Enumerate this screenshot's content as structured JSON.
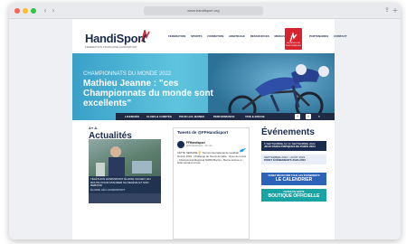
{
  "browser": {
    "url": "www.handisport.org",
    "nav_back": "‹",
    "nav_forward": "›",
    "share_icon": "share-icon",
    "add_tab_icon": "plus-icon"
  },
  "site": {
    "logo": "HandiSport",
    "logo_sub": "FÉDÉRATION FRANÇAISE HANDISPORT",
    "nav_left": [
      "FÉDÉRATION",
      "SPORTS",
      "FORMATION",
      "ARBITRAGE",
      "RESSOURCES",
      "MÉDIAS"
    ],
    "flag_text": "AGITATEUR DE PERFORMANCES",
    "nav_right": [
      "PARTENAIRES",
      "CONTACT"
    ],
    "hero_kicker": "CHAMPIONNATS DU MONDE 2022",
    "hero_title": "Mathieu Jeanne : \"ces Championnats du monde sont excellents\"",
    "toolbar": [
      "LICENCIÉS",
      "CLUBS & COMITÉS",
      "POUR LES JEUNES",
      "PERFORMANCE",
      "VIVE & BOUGE"
    ],
    "font_size_control": "A+ A-",
    "news_title": "Actualités",
    "news_caption": "TÉLÉTHON HANDISPORT ÉLODIE VACHET, EN ROUTE POUR ASSURER SA RELÈVE ET SON REBOND",
    "news_more": "ÉLODIE LÉO HANDISPORT"
  },
  "tweets": {
    "title": "Tweets de @FFHandisport",
    "name": "FFHandisport",
    "handle": "@FFHandisport · 40 min",
    "text": "CETTE SEMAINE 🏆 Tournoi international de Goalball féminin 2022 · Challenge de Tennis de table · Open de tennis · Championnat Régional NORM Boccia · Bonne lecture et belle semaine à tous"
  },
  "events": {
    "title": "Événements",
    "items": [
      {
        "date": "6 SEPTEMBRE AU 11 SEPTEMBRE 2022",
        "label": "JEUX PARALYMPIQUES DE PARIS 2024"
      },
      {
        "date": "SEPTEMBRE 2022 > AOÛT 2023",
        "label": "POINT ÉVÉNEMENTS 2022-2023"
      }
    ],
    "promo1_top": "VENEZ DÉCOUVRIR TOUS LES ÉVÉNEMENTS",
    "promo1_label": "LE CALENDRIER",
    "promo2_top": "FAITES UN GESTE",
    "promo2_label": "BOUTIQUE OFFICIELLE"
  },
  "colors": {
    "navy": "#1a2b4f",
    "red": "#d8222e",
    "hero_blue": "#3aa0c8",
    "promo_blue": "#2a63b8",
    "promo_teal": "#1aa3a3"
  }
}
